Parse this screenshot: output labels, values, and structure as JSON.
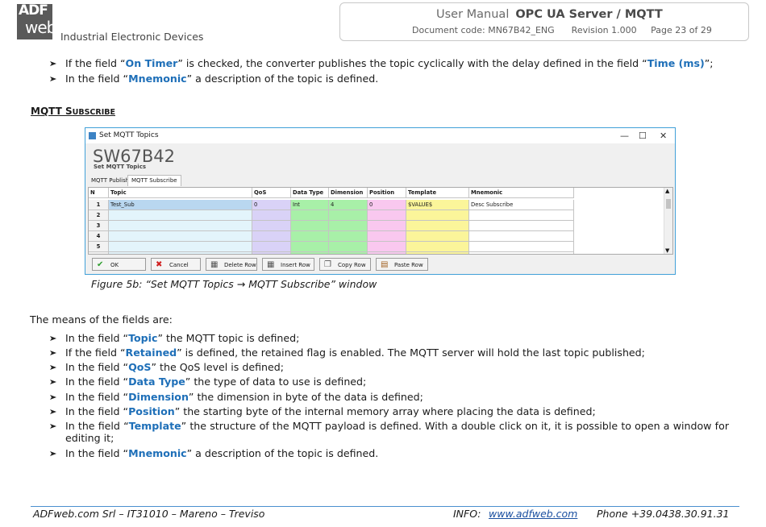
{
  "header": {
    "logo_top": "ADF",
    "logo_bottom": "web",
    "tagline": "Industrial Electronic Devices",
    "manual": "User Manual",
    "product": "OPC UA Server / MQTT",
    "doc_code": "Document code: MN67B42_ENG",
    "revision": "Revision 1.000",
    "page": "Page 23 of 29"
  },
  "top_bullets": [
    {
      "pre": "If the field “",
      "kw": "On Timer",
      "mid": "” is checked, the converter publishes the topic cyclically with the delay defined in the field “",
      "kw2": "Time (ms)",
      "post": "”;"
    },
    {
      "pre": "In the field “",
      "kw": "Mnemonic",
      "post": "” a description of the topic is defined."
    }
  ],
  "section": {
    "first": "MQTT S",
    "rest": "UBSCRIBE"
  },
  "window": {
    "title": "Set MQTT Topics",
    "controls": {
      "min": "—",
      "max": "☐",
      "close": "✕"
    },
    "device": "SW67B42",
    "subtitle": "Set MQTT Topics",
    "tabs": [
      "MQTT Publish",
      "MQTT Subscribe"
    ],
    "columns": [
      "N",
      "Topic",
      "QoS",
      "Data Type",
      "Dimension",
      "Position",
      "Template",
      "Mnemonic"
    ],
    "rows": [
      [
        "1",
        "Test_Sub",
        "0",
        "Int",
        "4",
        "0",
        "$VALUE$",
        "Desc Subscribe"
      ],
      [
        "2",
        "",
        "",
        "",
        "",
        "",
        "",
        ""
      ],
      [
        "3",
        "",
        "",
        "",
        "",
        "",
        "",
        ""
      ],
      [
        "4",
        "",
        "",
        "",
        "",
        "",
        "",
        ""
      ],
      [
        "5",
        "",
        "",
        "",
        "",
        "",
        "",
        ""
      ]
    ],
    "column_colors": [
      "#f2f2f2",
      "#e3f4fb",
      "#d9d2f7",
      "#a8f0a8",
      "#a8f0a8",
      "#f9c8ef",
      "#fbf59a",
      "#ffffff"
    ],
    "buttons": [
      {
        "icon": "✔",
        "icon_color": "#2e9e2e",
        "label": "OK"
      },
      {
        "icon": "✖",
        "icon_color": "#d02020",
        "label": "Cancel"
      },
      {
        "icon": "▦",
        "icon_color": "#555555",
        "label": "Delete Row"
      },
      {
        "icon": "▦",
        "icon_color": "#555555",
        "label": "Insert Row"
      },
      {
        "icon": "❐",
        "icon_color": "#555555",
        "label": "Copy Row"
      },
      {
        "icon": "▤",
        "icon_color": "#a06020",
        "label": "Paste Row"
      }
    ]
  },
  "caption": "Figure 5b: “Set MQTT Topics → MQTT Subscribe” window",
  "means_intro": "The means of the fields are:",
  "bullets": [
    {
      "pre": "In the field “",
      "kw": "Topic",
      "post": "” the MQTT topic is defined;"
    },
    {
      "pre": "If the field “",
      "kw": "Retained",
      "post": "” is defined, the retained flag is enabled. The MQTT server will hold the last topic published;"
    },
    {
      "pre": "In the field “",
      "kw": "QoS",
      "post": "” the QoS level is defined;"
    },
    {
      "pre": "In the field “",
      "kw": "Data Type",
      "post": "” the type of data to use is defined;"
    },
    {
      "pre": "In the field “",
      "kw": "Dimension",
      "post": "” the dimension in byte of the data is defined;"
    },
    {
      "pre": "In the field “",
      "kw": "Position",
      "post": "” the starting byte of the internal memory array where placing the data is defined;"
    },
    {
      "pre": "In the field “",
      "kw": "Template",
      "post": "” the structure of the MQTT payload is defined. With a double click on it, it is possible to open a window for",
      "post2": "editing it;"
    },
    {
      "pre": "In the field “",
      "kw": "Mnemonic",
      "post": "” a description of the topic is defined."
    }
  ],
  "footer": {
    "company": "ADFweb.com Srl – IT31010 – Mareno – Treviso",
    "info_label": "INFO:",
    "url": "www.adfweb.com",
    "phone": "Phone +39.0438.30.91.31"
  }
}
